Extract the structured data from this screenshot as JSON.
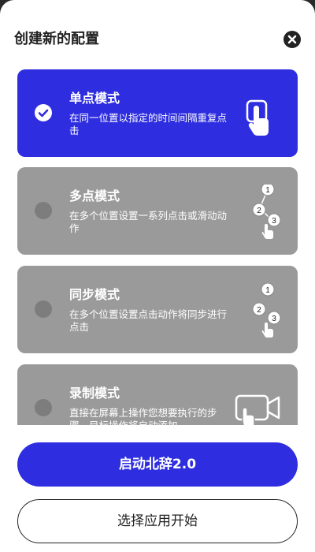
{
  "header": {
    "title": "创建新的配置"
  },
  "modes": [
    {
      "title": "单点模式",
      "description": "在同一位置以指定的时间间隔重复点击",
      "selected": true,
      "icon": "single-tap-icon"
    },
    {
      "title": "多点模式",
      "description": "在多个位置设置一系列点击或滑动动作",
      "selected": false,
      "icon": "multi-tap-icon",
      "icon_numbers": [
        "1",
        "2",
        "3"
      ]
    },
    {
      "title": "同步模式",
      "description": "在多个位置设置点击动作将同步进行点击",
      "selected": false,
      "icon": "sync-tap-icon",
      "icon_numbers": [
        "1",
        "2",
        "3"
      ]
    },
    {
      "title": "录制模式",
      "description": "直接在屏幕上操作您想要执行的步骤，目标操作将自动添加",
      "selected": false,
      "icon": "record-icon"
    }
  ],
  "buttons": {
    "primary_label": "启动北辞2.0",
    "secondary_label": "选择应用开始"
  },
  "colors": {
    "accent": "#2e2ee0",
    "card_inactive": "#9a9a9a",
    "sheet_bg": "#ffffff"
  }
}
